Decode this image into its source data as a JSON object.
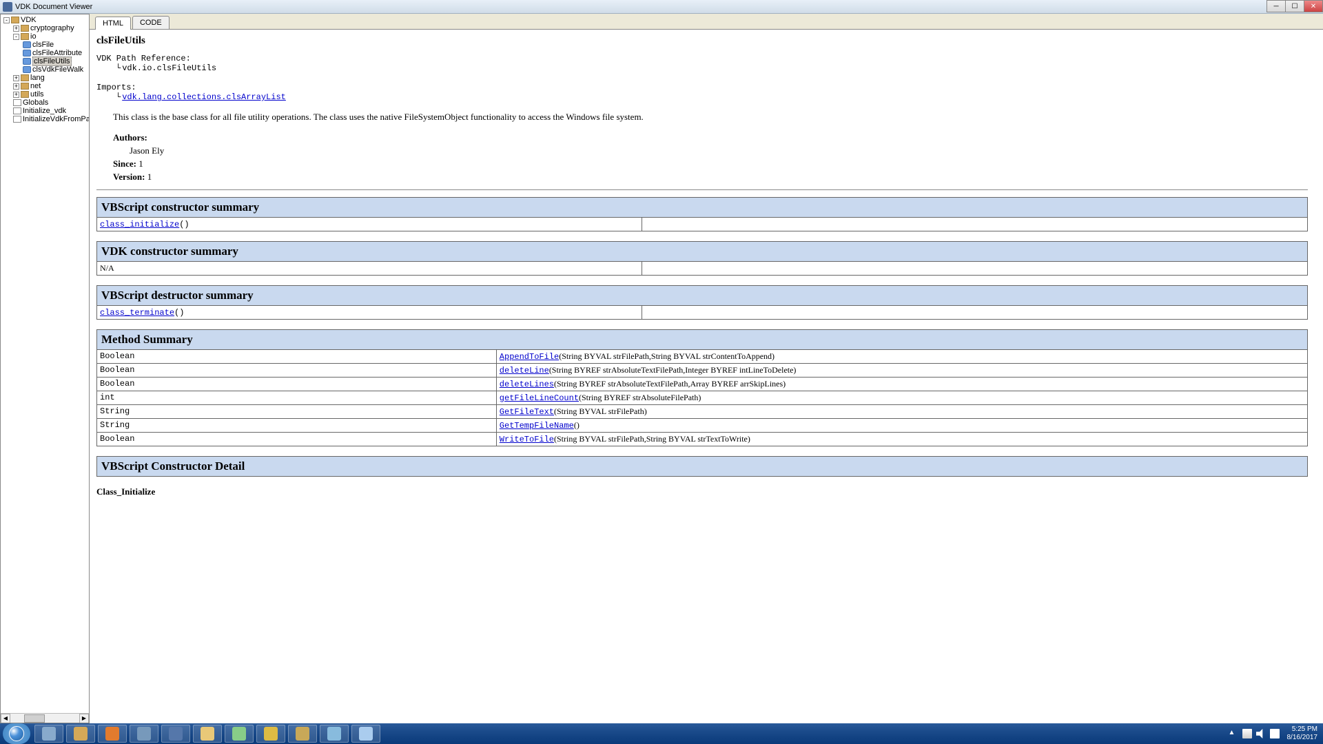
{
  "window": {
    "title": "VDK Document Viewer"
  },
  "tree": {
    "root": "VDK",
    "cryptography": "cryptography",
    "io": "io",
    "clsFile": "clsFile",
    "clsFileAttribute": "clsFileAttribute",
    "clsFileUtils": "clsFileUtils",
    "clsVdkFileWalk": "clsVdkFileWalk",
    "lang": "lang",
    "net": "net",
    "utils": "utils",
    "globals": "Globals",
    "initVdk": "Initialize_vdk",
    "initFromPath": "InitializeVdkFromPath"
  },
  "tabs": {
    "html": "HTML",
    "code": "CODE"
  },
  "doc": {
    "className": "clsFileUtils",
    "pathRefLabel": "VDK Path Reference:",
    "pathRef": "vdk.io.clsFileUtils",
    "importsLabel": "Imports:",
    "import1": "vdk.lang.collections.clsArrayList",
    "description": "This class is the base class for all file utility operations. The class uses the native FileSystemObject functionality to access the Windows file system.",
    "authorsLabel": "Authors:",
    "author1": "Jason Ely",
    "sinceLabel": "Since:",
    "sinceVal": "1",
    "versionLabel": "Version:",
    "versionVal": "1"
  },
  "sections": {
    "vbCtor": "VBScript constructor summary",
    "vdkCtor": "VDK constructor summary",
    "vbDtor": "VBScript destructor summary",
    "methods": "Method Summary",
    "ctorDetail": "VBScript Constructor Detail",
    "classInit": "Class_Initialize"
  },
  "ctor": {
    "name": "class_initialize",
    "params": "()"
  },
  "vdkCtorRow": "N/A",
  "dtor": {
    "name": "class_terminate",
    "params": "()"
  },
  "methods": [
    {
      "ret": "Boolean",
      "name": "AppendToFile",
      "params": "(String BYVAL strFilePath,String BYVAL strContentToAppend)"
    },
    {
      "ret": "Boolean",
      "name": "deleteLine",
      "params": "(String BYREF strAbsoluteTextFilePath,Integer BYREF intLineToDelete)"
    },
    {
      "ret": "Boolean",
      "name": "deleteLines",
      "params": "(String BYREF strAbsoluteTextFilePath,Array BYREF arrSkipLines)"
    },
    {
      "ret": "int",
      "name": "getFileLineCount",
      "params": "(String BYREF strAbsoluteFilePath)"
    },
    {
      "ret": "String",
      "name": "GetFileText",
      "params": "(String BYVAL strFilePath)"
    },
    {
      "ret": "String",
      "name": "GetTempFileName",
      "params": "()"
    },
    {
      "ret": "Boolean",
      "name": "WriteToFile",
      "params": "(String BYVAL strFilePath,String BYVAL strTextToWrite)"
    }
  ],
  "taskbarIcons": [
    {
      "name": "cube",
      "color": "#88aacc"
    },
    {
      "name": "tool",
      "color": "#d4a858"
    },
    {
      "name": "firefox",
      "color": "#e27b2e"
    },
    {
      "name": "app4",
      "color": "#7799bb"
    },
    {
      "name": "vbox",
      "color": "#5577aa"
    },
    {
      "name": "explorer",
      "color": "#e8c878"
    },
    {
      "name": "app7",
      "color": "#88cc88"
    },
    {
      "name": "app8",
      "color": "#ddbb44"
    },
    {
      "name": "app9",
      "color": "#c8a858"
    },
    {
      "name": "settings",
      "color": "#88bbdd"
    },
    {
      "name": "paint",
      "color": "#aaccee"
    }
  ],
  "clock": {
    "time": "5:25 PM",
    "date": "8/16/2017"
  }
}
